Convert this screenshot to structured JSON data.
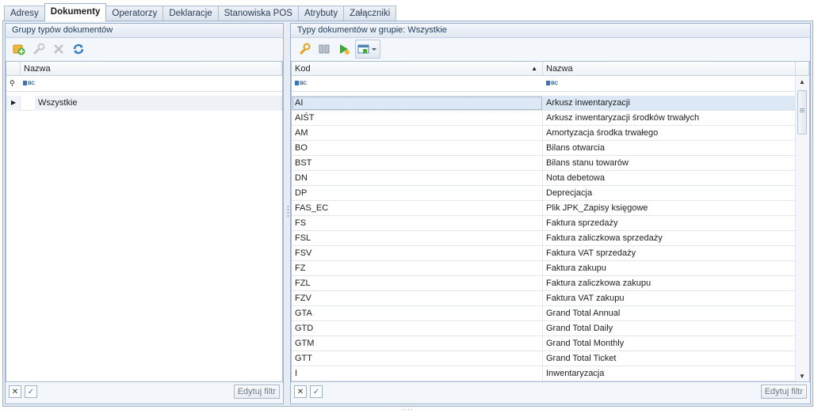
{
  "tabs": [
    {
      "label": "Adresy",
      "active": false
    },
    {
      "label": "Dokumenty",
      "active": true
    },
    {
      "label": "Operatorzy",
      "active": false
    },
    {
      "label": "Deklaracje",
      "active": false
    },
    {
      "label": "Stanowiska POS",
      "active": false
    },
    {
      "label": "Atrybuty",
      "active": false
    },
    {
      "label": "Załączniki",
      "active": false
    }
  ],
  "left_panel": {
    "title": "Grupy typów dokumentów",
    "column": "Nazwa",
    "rows": [
      {
        "name": "Wszystkie"
      }
    ],
    "edit_filter_label": "Edytuj filtr"
  },
  "right_panel": {
    "title": "Typy dokumentów w grupie: Wszystkie",
    "columns": {
      "code": "Kod",
      "name": "Nazwa"
    },
    "rows": [
      {
        "code": "AI",
        "name": "Arkusz inwentaryzacji"
      },
      {
        "code": "AIŚT",
        "name": "Arkusz inwentaryzacji środków trwałych"
      },
      {
        "code": "AM",
        "name": "Amortyzacja środka trwałego"
      },
      {
        "code": "BO",
        "name": "Bilans otwarcia"
      },
      {
        "code": "BST",
        "name": "Bilans stanu towarów"
      },
      {
        "code": "DN",
        "name": "Nota debetowa"
      },
      {
        "code": "DP",
        "name": "Deprecjacja"
      },
      {
        "code": "FAS_EC",
        "name": "Plik JPK_Zapisy księgowe"
      },
      {
        "code": "FS",
        "name": "Faktura sprzedaży"
      },
      {
        "code": "FSL",
        "name": "Faktura zaliczkowa sprzedaży"
      },
      {
        "code": "FSV",
        "name": "Faktura VAT sprzedaży"
      },
      {
        "code": "FZ",
        "name": "Faktura zakupu"
      },
      {
        "code": "FZL",
        "name": "Faktura zaliczkowa zakupu"
      },
      {
        "code": "FZV",
        "name": "Faktura VAT zakupu"
      },
      {
        "code": "GTA",
        "name": "Grand Total Annual"
      },
      {
        "code": "GTD",
        "name": "Grand Total Daily"
      },
      {
        "code": "GTM",
        "name": "Grand Total Monthly"
      },
      {
        "code": "GTT",
        "name": "Grand Total Ticket"
      },
      {
        "code": "I",
        "name": "Inwentaryzacja"
      }
    ],
    "edit_filter_label": "Edytuj filtr"
  },
  "filter_glyph": "BC",
  "colors": {
    "accent": "#3a73b8",
    "selection": "#dce8f6",
    "border": "#9cb2cc"
  }
}
